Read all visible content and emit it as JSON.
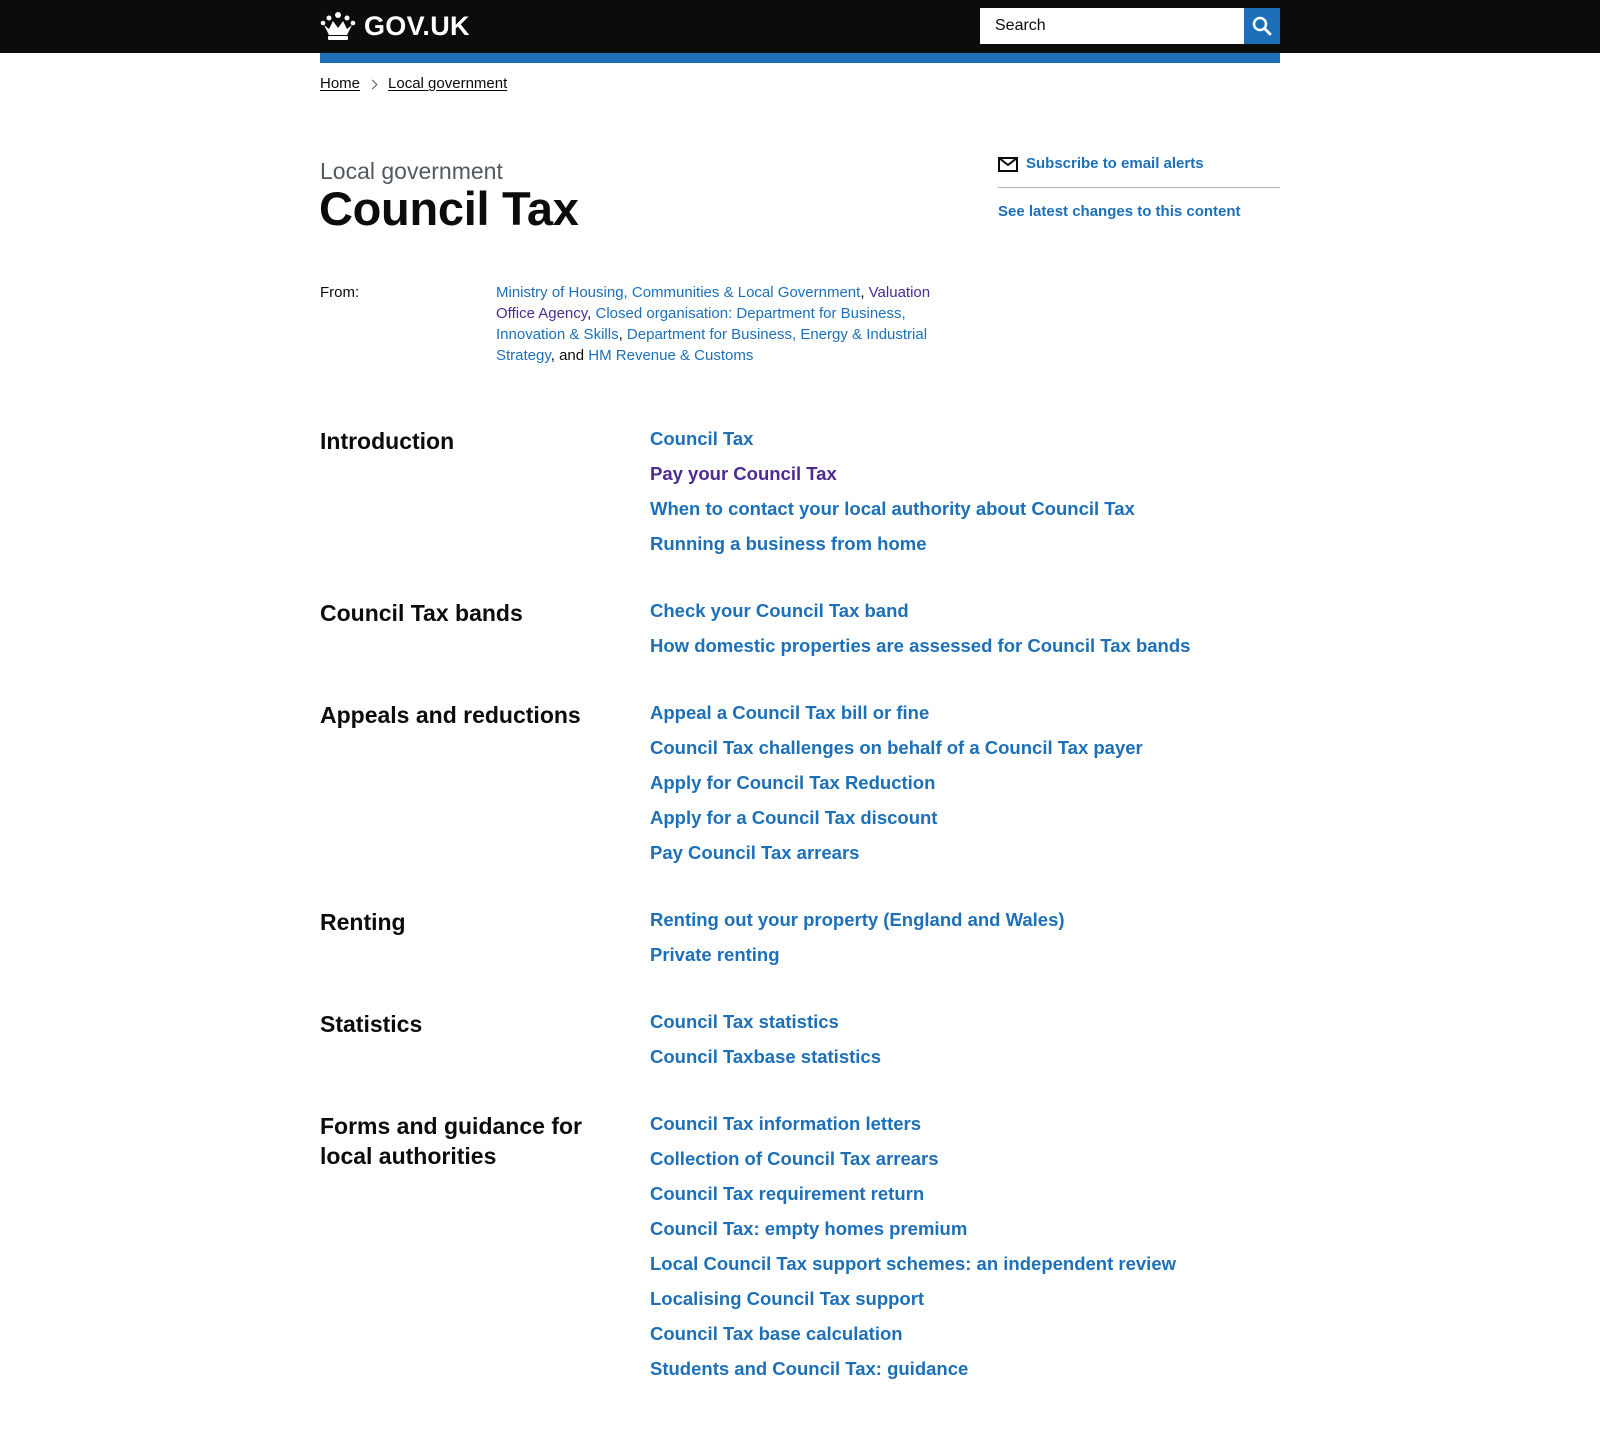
{
  "header": {
    "logo_text": "GOV.UK",
    "search": {
      "placeholder": "Search"
    },
    "colors": {
      "background": "#0b0c0c",
      "accent": "#1d70b8"
    }
  },
  "breadcrumbs": [
    "Home",
    "Local government"
  ],
  "page": {
    "caption": "Local government",
    "title": "Council Tax"
  },
  "sidebar": {
    "subscribe_label": "Subscribe to email alerts",
    "changes_label": "See latest changes to this content"
  },
  "from": {
    "label": "From:",
    "orgs": [
      "Ministry of Housing, Communities & Local Government",
      "Valuation Office Agency",
      "Closed organisation: Department for Business, Innovation & Skills",
      "Department for Business, Energy & Industrial Strategy",
      "HM Revenue & Customs"
    ],
    "separator": ", ",
    "last_separator": ", and "
  },
  "sections": [
    {
      "title": "Introduction",
      "links": [
        "Council Tax",
        "Pay your Council Tax",
        "When to contact your local authority about Council Tax",
        "Running a business from home"
      ]
    },
    {
      "title": "Council Tax bands",
      "links": [
        "Check your Council Tax band",
        "How domestic properties are assessed for Council Tax bands"
      ]
    },
    {
      "title": "Appeals and reductions",
      "links": [
        "Appeal a Council Tax bill or fine",
        "Council Tax challenges on behalf of a Council Tax payer",
        "Apply for Council Tax Reduction",
        "Apply for a Council Tax discount",
        "Pay Council Tax arrears"
      ]
    },
    {
      "title": "Renting",
      "links": [
        "Renting out your property (England and Wales)",
        "Private renting"
      ]
    },
    {
      "title": "Statistics",
      "links": [
        "Council Tax statistics",
        "Council Taxbase statistics"
      ]
    },
    {
      "title": "Forms and guidance for local authorities",
      "links": [
        "Council Tax information letters",
        "Collection of Council Tax arrears",
        "Council Tax requirement return",
        "Council Tax: empty homes premium",
        "Local Council Tax support schemes: an independent review",
        "Localising Council Tax support",
        "Council Tax base calculation",
        "Students and Council Tax: guidance"
      ]
    }
  ]
}
